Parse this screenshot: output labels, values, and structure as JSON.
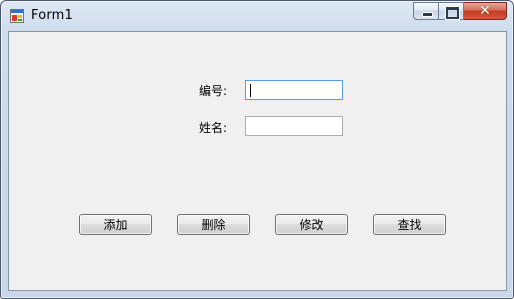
{
  "window": {
    "title": "Form1"
  },
  "titlebar": {
    "minimize_icon": "minimize-icon",
    "maximize_icon": "maximize-icon",
    "close_icon": "close-icon",
    "close_glyph": "✕"
  },
  "form": {
    "id_label": "编号:",
    "id_value": "",
    "name_label": "姓名:",
    "name_value": ""
  },
  "buttons": {
    "add": "添加",
    "delete": "删除",
    "modify": "修改",
    "search": "查找"
  },
  "colors": {
    "client_background": "#f0f0f0",
    "close_button": "#c23d23",
    "focus_border": "#569de5"
  }
}
